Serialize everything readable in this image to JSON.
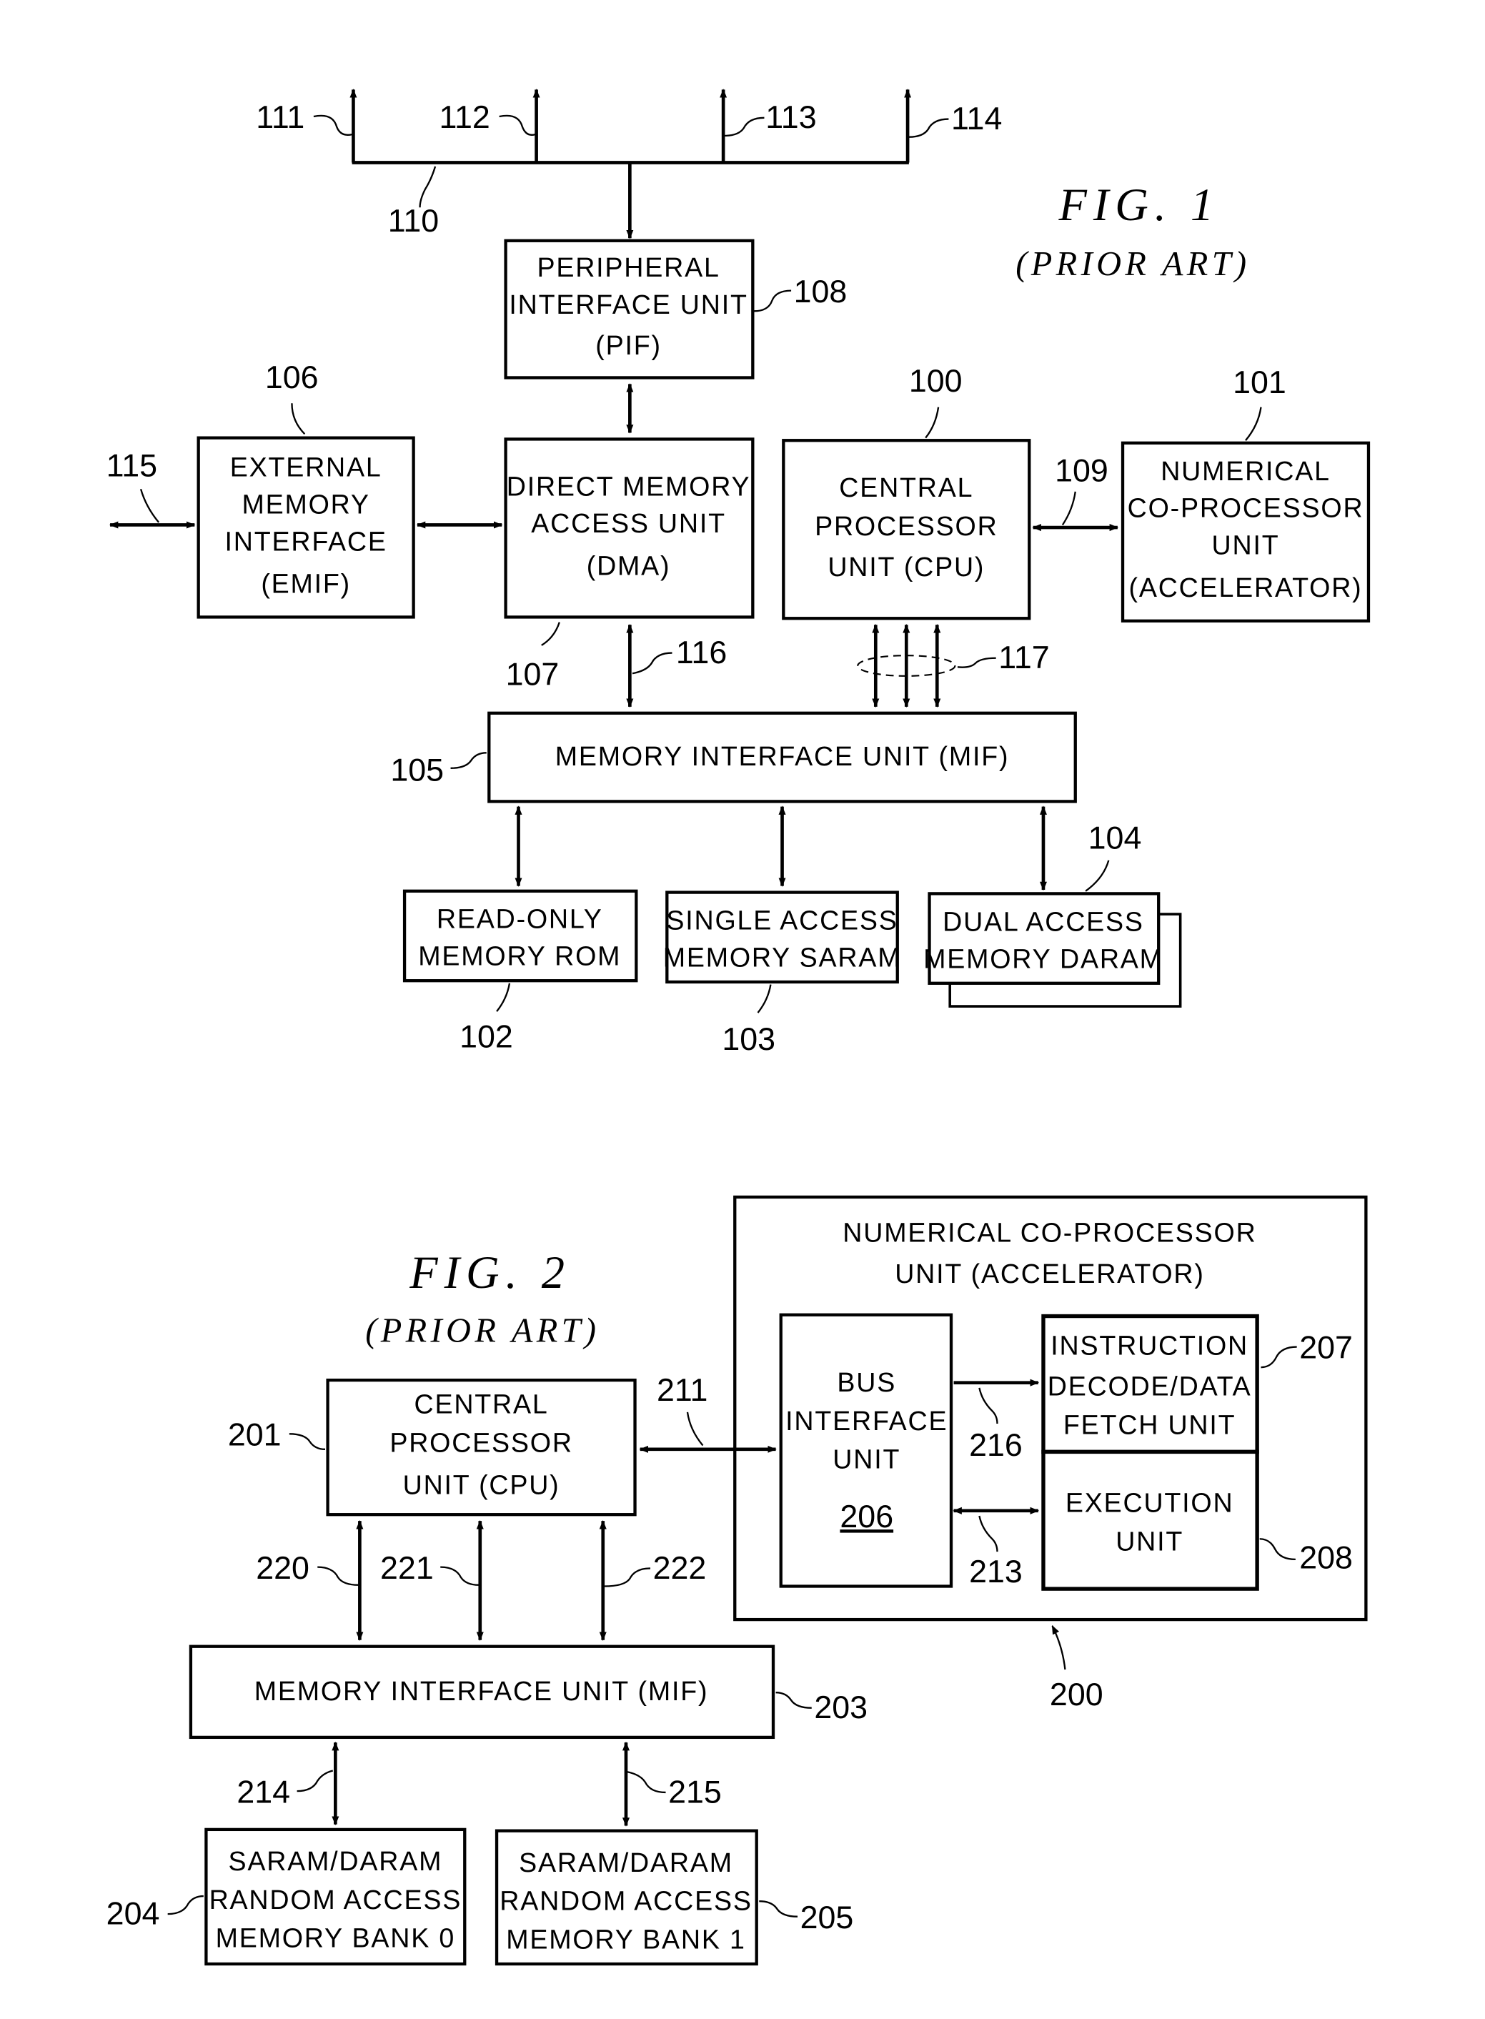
{
  "fig1": {
    "title": "FIG. 1",
    "subtitle": "(PRIOR ART)",
    "blocks": {
      "pif": [
        "PERIPHERAL",
        "INTERFACE UNIT",
        "(PIF)"
      ],
      "emif": [
        "EXTERNAL",
        "MEMORY",
        "INTERFACE",
        "(EMIF)"
      ],
      "dma": [
        "DIRECT MEMORY",
        "ACCESS UNIT",
        "(DMA)"
      ],
      "cpu": [
        "CENTRAL",
        "PROCESSOR",
        "UNIT (CPU)"
      ],
      "accel": [
        "NUMERICAL",
        "CO-PROCESSOR",
        "UNIT",
        "(ACCELERATOR)"
      ],
      "mif": [
        "MEMORY INTERFACE UNIT (MIF)"
      ],
      "rom": [
        "READ-ONLY",
        "MEMORY ROM"
      ],
      "saram": [
        "SINGLE ACCESS",
        "MEMORY SARAM"
      ],
      "daram": [
        "DUAL ACCESS",
        "MEMORY DARAM"
      ]
    },
    "refs": {
      "r100": "100",
      "r101": "101",
      "r102": "102",
      "r103": "103",
      "r104": "104",
      "r105": "105",
      "r106": "106",
      "r107": "107",
      "r108": "108",
      "r109": "109",
      "r110": "110",
      "r111": "111",
      "r112": "112",
      "r113": "113",
      "r114": "114",
      "r115": "115",
      "r116": "116",
      "r117": "117"
    }
  },
  "fig2": {
    "title": "FIG. 2",
    "subtitle": "(PRIOR ART)",
    "blocks": {
      "accel": [
        "NUMERICAL CO-PROCESSOR",
        "UNIT (ACCELERATOR)"
      ],
      "biu": [
        "BUS",
        "INTERFACE",
        "UNIT"
      ],
      "biu_ref": "206",
      "idf": [
        "INSTRUCTION",
        "DECODE/DATA",
        "FETCH UNIT"
      ],
      "exec": [
        "EXECUTION",
        "UNIT"
      ],
      "cpu": [
        "CENTRAL",
        "PROCESSOR",
        "UNIT (CPU)"
      ],
      "mif": [
        "MEMORY INTERFACE UNIT (MIF)"
      ],
      "bank0": [
        "SARAM/DARAM",
        "RANDOM ACCESS",
        "MEMORY BANK 0"
      ],
      "bank1": [
        "SARAM/DARAM",
        "RANDOM ACCESS",
        "MEMORY BANK 1"
      ]
    },
    "refs": {
      "r200": "200",
      "r201": "201",
      "r203": "203",
      "r204": "204",
      "r205": "205",
      "r207": "207",
      "r208": "208",
      "r211": "211",
      "r213": "213",
      "r214": "214",
      "r215": "215",
      "r216": "216",
      "r220": "220",
      "r221": "221",
      "r222": "222"
    }
  }
}
